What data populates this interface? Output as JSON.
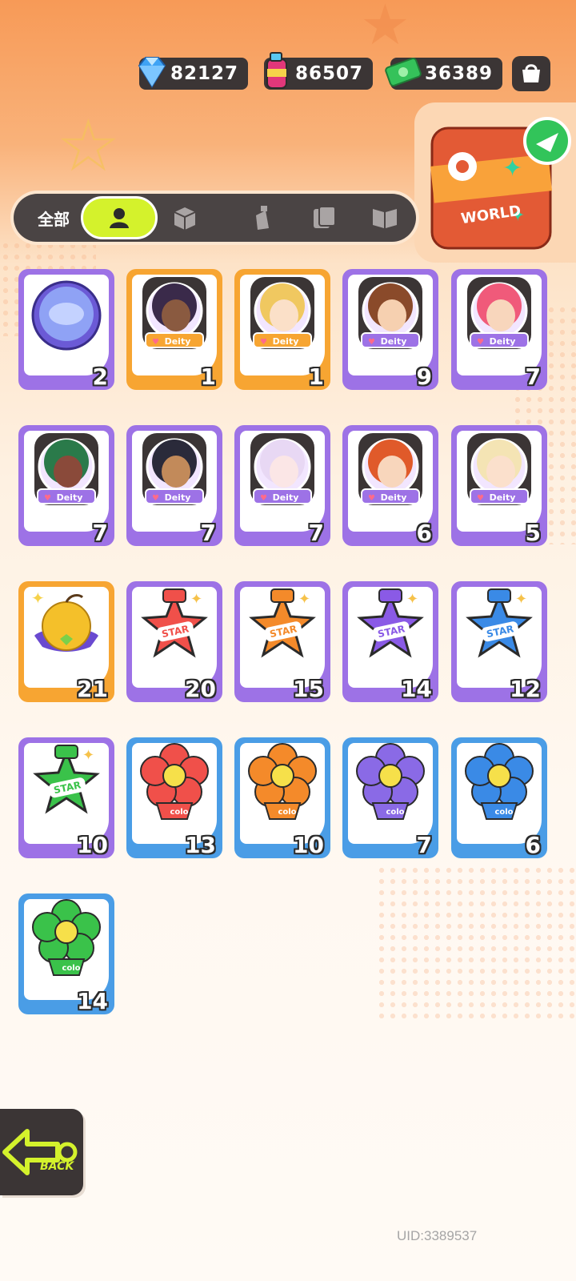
{
  "currencies": [
    {
      "name": "diamond-icon",
      "value": "82127",
      "color": "#3fa3f5"
    },
    {
      "name": "spray-can-icon",
      "value": "86507",
      "color": "#e2377a"
    },
    {
      "name": "cash-icon",
      "value": "36389",
      "color": "#35c25a"
    }
  ],
  "world_chest": {
    "label": "WORLD"
  },
  "tabs": {
    "all": "全部"
  },
  "items": [
    {
      "kind": "coin",
      "frame": "purple",
      "count": "2"
    },
    {
      "kind": "deity",
      "frame": "orange",
      "count": "1",
      "hair": "#3a2a4a",
      "skin": "#8a5a40",
      "label": "Deity"
    },
    {
      "kind": "deity",
      "frame": "orange",
      "count": "1",
      "hair": "#f0c860",
      "skin": "#fbe0c8",
      "label": "Deity"
    },
    {
      "kind": "deity",
      "frame": "purple",
      "count": "9",
      "hair": "#8a4a2a",
      "skin": "#f6d0b0",
      "label": "Deity"
    },
    {
      "kind": "deity",
      "frame": "purple",
      "count": "7",
      "hair": "#f05a7a",
      "skin": "#f8d6bc",
      "label": "Deity"
    },
    {
      "kind": "deity",
      "frame": "purple",
      "count": "7",
      "hair": "#2a7a4a",
      "skin": "#8a4a3a",
      "label": "Deity"
    },
    {
      "kind": "deity",
      "frame": "purple",
      "count": "7",
      "hair": "#2a2a3a",
      "skin": "#c28a5a",
      "label": "Deity"
    },
    {
      "kind": "deity",
      "frame": "purple",
      "count": "7",
      "hair": "#e8d8f4",
      "skin": "#fbe6e6",
      "label": "Deity"
    },
    {
      "kind": "deity",
      "frame": "purple",
      "count": "6",
      "hair": "#e05a2a",
      "skin": "#f8d6bc",
      "label": "Deity"
    },
    {
      "kind": "deity",
      "frame": "purple",
      "count": "5",
      "hair": "#f4e4b4",
      "skin": "#fbe0cc",
      "label": "Deity"
    },
    {
      "kind": "apple",
      "frame": "orange",
      "count": "21"
    },
    {
      "kind": "star",
      "frame": "purple",
      "count": "20",
      "color": "#f0504a",
      "label": "STAR"
    },
    {
      "kind": "star",
      "frame": "purple",
      "count": "15",
      "color": "#f48a2a",
      "label": "STAR"
    },
    {
      "kind": "star",
      "frame": "purple",
      "count": "14",
      "color": "#8a5ae6",
      "label": "STAR"
    },
    {
      "kind": "star",
      "frame": "purple",
      "count": "12",
      "color": "#3a8ae6",
      "label": "STAR"
    },
    {
      "kind": "star",
      "frame": "purple",
      "count": "10",
      "color": "#3ac24a",
      "label": "STAR"
    },
    {
      "kind": "flower",
      "frame": "blue",
      "count": "13",
      "color": "#f0504a",
      "label": "colo"
    },
    {
      "kind": "flower",
      "frame": "blue",
      "count": "10",
      "color": "#f48a2a",
      "label": "colo"
    },
    {
      "kind": "flower",
      "frame": "blue",
      "count": "7",
      "color": "#8a6ae6",
      "label": "colo"
    },
    {
      "kind": "flower",
      "frame": "blue",
      "count": "6",
      "color": "#3a8ae6",
      "label": "colo"
    },
    {
      "kind": "flower",
      "frame": "blue",
      "count": "14",
      "color": "#3ac24a",
      "label": "colo"
    }
  ],
  "back_label": "BACK",
  "uid": "UID:3389537"
}
